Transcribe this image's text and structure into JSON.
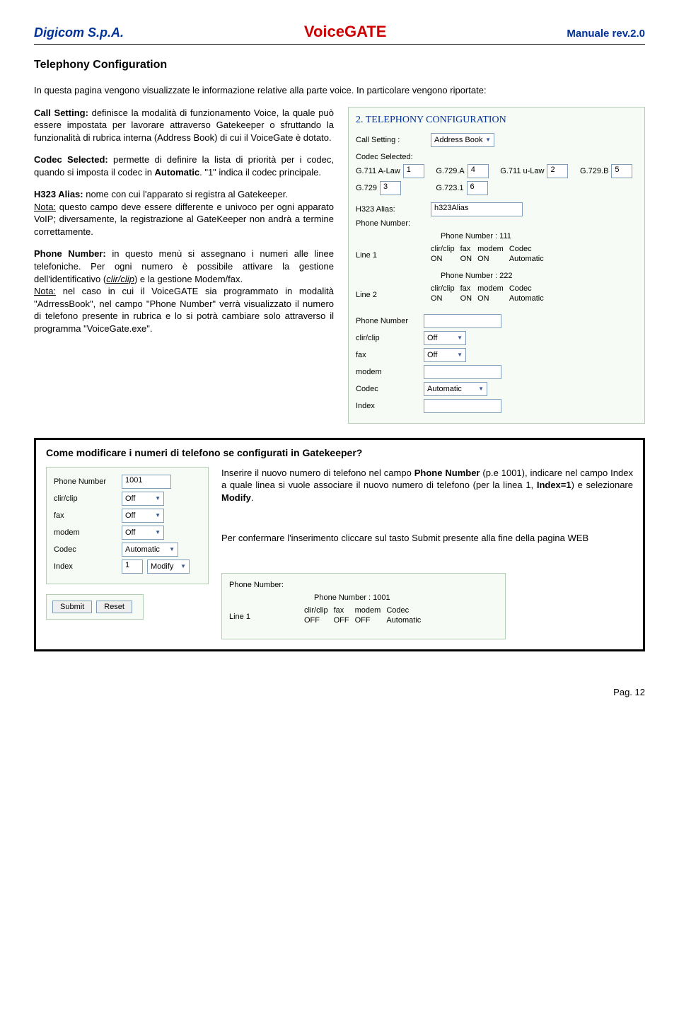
{
  "header": {
    "left": "Digicom S.p.A.",
    "center": "VoiceGATE",
    "right": "Manuale rev.2.0"
  },
  "title": "Telephony Configuration",
  "intro": "In questa pagina vengono visualizzate le informazione relative alla parte voice. In particolare vengono riportate:",
  "p_callsetting_label": "Call Setting:",
  "p_callsetting_text": " definisce la modalità di funzionamento Voice, la quale può essere impostata per lavorare attraverso Gatekeeper o sfruttando la funzionalità di rubrica interna (Address Book) di cui il VoiceGate è dotato.",
  "p_codec_label": "Codec Selected:",
  "p_codec_text": " permette di definire la lista di priorità per i codec, quando si imposta il codec in ",
  "p_codec_auto": "Automatic",
  "p_codec_tail": ". \"1\" indica il codec principale.",
  "p_h323_label": "H323 Alias:",
  "p_h323_text": " nome con cui l'apparato si registra al Gatekeeper.",
  "p_h323_nota_label": "Nota:",
  "p_h323_nota_text": " questo campo deve essere differente e univoco per ogni apparato VoIP; diversamente, la registrazione al GateKeeper non andrà a termine correttamente.",
  "p_phone_label": "Phone Number:",
  "p_phone_text": " in questo menù si assegnano i numeri alle linee telefoniche. Per ogni numero è possibile attivare la gestione dell'identificativo (",
  "p_phone_clir": "clir/clip",
  "p_phone_text2": ") e la gestione Modem/fax.",
  "p_phone_nota_label": "Nota:",
  "p_phone_nota_text": " nel caso in cui il VoiceGATE sia programmato in modalità \"AdrressBook\", nel campo \"Phone Number\" verrà visualizzato il numero di telefono presente in rubrica e lo si potrà cambiare solo attraverso il programma \"VoiceGate.exe\".",
  "callout": {
    "title": "Come modificare i numeri di telefono se configurati in Gatekeeper?",
    "p1a": "Inserire il nuovo numero di telefono nel campo ",
    "p1b": "Phone Number",
    "p1c": " (p.e 1001), indicare nel campo Index a quale linea si vuole associare il nuovo numero di telefono (per la linea 1, ",
    "p1d": "Index=1",
    "p1e": ") e selezionare ",
    "p1f": "Modify",
    "p1g": ".",
    "p2": "Per confermare l'inserimento cliccare sul tasto Submit presente alla fine della pagina WEB"
  },
  "ui_main": {
    "title": "2. TELEPHONY CONFIGURATION",
    "call_setting_label": "Call Setting :",
    "call_setting_value": "Address Book",
    "codec_selected_label": "Codec Selected:",
    "codec": {
      "g711a": "G.711 A-Law",
      "g711a_v": "1",
      "g729a": "G.729.A",
      "g729a_v": "4",
      "g711u": "G.711 u-Law",
      "g711u_v": "2",
      "g729b": "G.729.B",
      "g729b_v": "5",
      "g729": "G.729",
      "g729_v": "3",
      "g7231": "G.723.1",
      "g7231_v": "6"
    },
    "h323_alias_label": "H323 Alias:",
    "h323_alias_value": "h323Alias",
    "phone_number_label": "Phone Number:",
    "line1_label": "Line 1",
    "line2_label": "Line 2",
    "pn111": "Phone Number : 111",
    "pn222": "Phone Number : 222",
    "th_clir": "clir/clip",
    "th_fax": "fax",
    "th_modem": "modem",
    "th_codec": "Codec",
    "on": "ON",
    "automatic": "Automatic",
    "sub_phone_label": "Phone Number",
    "sub_clir": "clir/clip",
    "sub_fax": "fax",
    "sub_modem": "modem",
    "sub_codec": "Codec",
    "sub_index": "Index",
    "off": "Off"
  },
  "ui_small": {
    "phone_label": "Phone Number",
    "phone_value": "1001",
    "clir": "clir/clip",
    "fax": "fax",
    "modem": "modem",
    "codec": "Codec",
    "index": "Index",
    "off": "Off",
    "automatic": "Automatic",
    "index_value": "1",
    "modify": "Modify",
    "submit": "Submit",
    "reset": "Reset"
  },
  "ui_bottom": {
    "phone_label": "Phone Number:",
    "line1_label": "Line 1",
    "pn1001": "Phone Number : 1001",
    "th_clir": "clir/clip",
    "th_fax": "fax",
    "th_modem": "modem",
    "th_codec": "Codec",
    "off": "OFF",
    "automatic": "Automatic"
  },
  "footer": "Pag. 12"
}
